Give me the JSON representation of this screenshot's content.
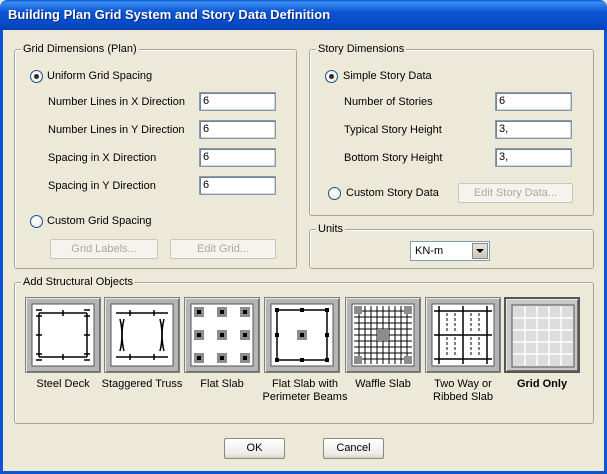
{
  "window": {
    "title": "Building Plan Grid System and Story Data Definition"
  },
  "grid_dimensions": {
    "legend": "Grid Dimensions (Plan)",
    "uniform_label": "Uniform Grid Spacing",
    "uniform_selected": true,
    "fields": [
      {
        "label": "Number Lines in X Direction",
        "value": "6"
      },
      {
        "label": "Number Lines in Y Direction",
        "value": "6"
      },
      {
        "label": "Spacing in X Direction",
        "value": "6"
      },
      {
        "label": "Spacing in Y Direction",
        "value": "6"
      }
    ],
    "custom_label": "Custom Grid Spacing",
    "grid_labels_button": "Grid Labels...",
    "edit_grid_button": "Edit Grid..."
  },
  "story_dimensions": {
    "legend": "Story Dimensions",
    "simple_label": "Simple Story Data",
    "simple_selected": true,
    "fields": [
      {
        "label": "Number of Stories",
        "value": "6"
      },
      {
        "label": "Typical Story Height",
        "value": "3,"
      },
      {
        "label": "Bottom Story Height",
        "value": "3,"
      }
    ],
    "custom_label": "Custom Story Data",
    "edit_story_button": "Edit Story Data..."
  },
  "units": {
    "legend": "Units",
    "selected": "KN-m"
  },
  "structural_objects": {
    "legend": "Add Structural Objects",
    "items": [
      {
        "label": "Steel Deck",
        "icon": "steel-deck-icon"
      },
      {
        "label": "Staggered Truss",
        "icon": "staggered-truss-icon"
      },
      {
        "label": "Flat Slab",
        "icon": "flat-slab-icon"
      },
      {
        "label": "Flat Slab with Perimeter Beams",
        "icon": "flat-slab-perimeter-icon"
      },
      {
        "label": "Waffle Slab",
        "icon": "waffle-slab-icon"
      },
      {
        "label": "Two Way or Ribbed Slab",
        "icon": "ribbed-slab-icon"
      },
      {
        "label": "Grid Only",
        "icon": "grid-only-icon",
        "selected": true
      }
    ]
  },
  "buttons": {
    "ok": "OK",
    "cancel": "Cancel"
  }
}
